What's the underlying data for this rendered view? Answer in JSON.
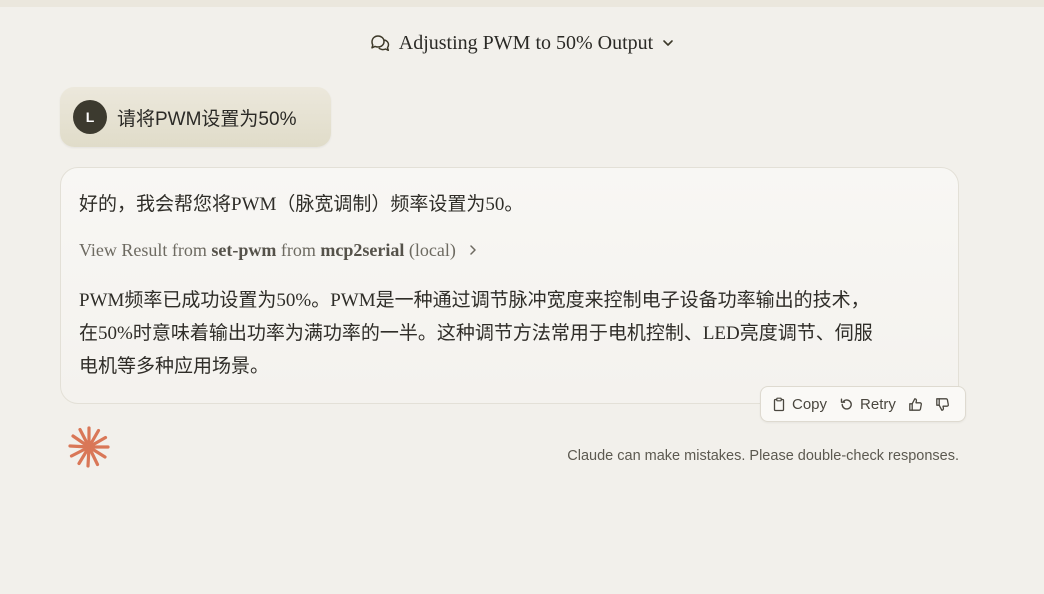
{
  "header": {
    "title": "Adjusting PWM to 50% Output",
    "chat_icon": "chat-bubbles-icon",
    "dropdown_icon": "chevron-down-icon"
  },
  "user_message": {
    "avatar_initial": "L",
    "text": "请将PWM设置为50%"
  },
  "assistant_message": {
    "intro": "好的，我会帮您将PWM（脉宽调制）频率设置为50。",
    "tool_result": {
      "prefix": "View Result from ",
      "tool": "set-pwm",
      "middle": " from ",
      "server": "mcp2serial",
      "suffix": " (local)"
    },
    "body": "PWM频率已成功设置为50%。PWM是一种通过调节脉冲宽度来控制电子设备功率输出的技术，在50%时意味着输出功率为满功率的一半。这种调节方法常用于电机控制、LED亮度调节、伺服电机等多种应用场景。"
  },
  "actions": {
    "copy_label": "Copy",
    "retry_label": "Retry",
    "copy_icon": "clipboard-icon",
    "retry_icon": "retry-icon",
    "thumbs_up_icon": "thumbs-up-icon",
    "thumbs_down_icon": "thumbs-down-icon"
  },
  "disclaimer": "Claude can make mistakes. Please double-check responses.",
  "colors": {
    "background": "#f2f0eb",
    "brand_orange": "#d97757",
    "avatar": "#3c3a2f"
  }
}
